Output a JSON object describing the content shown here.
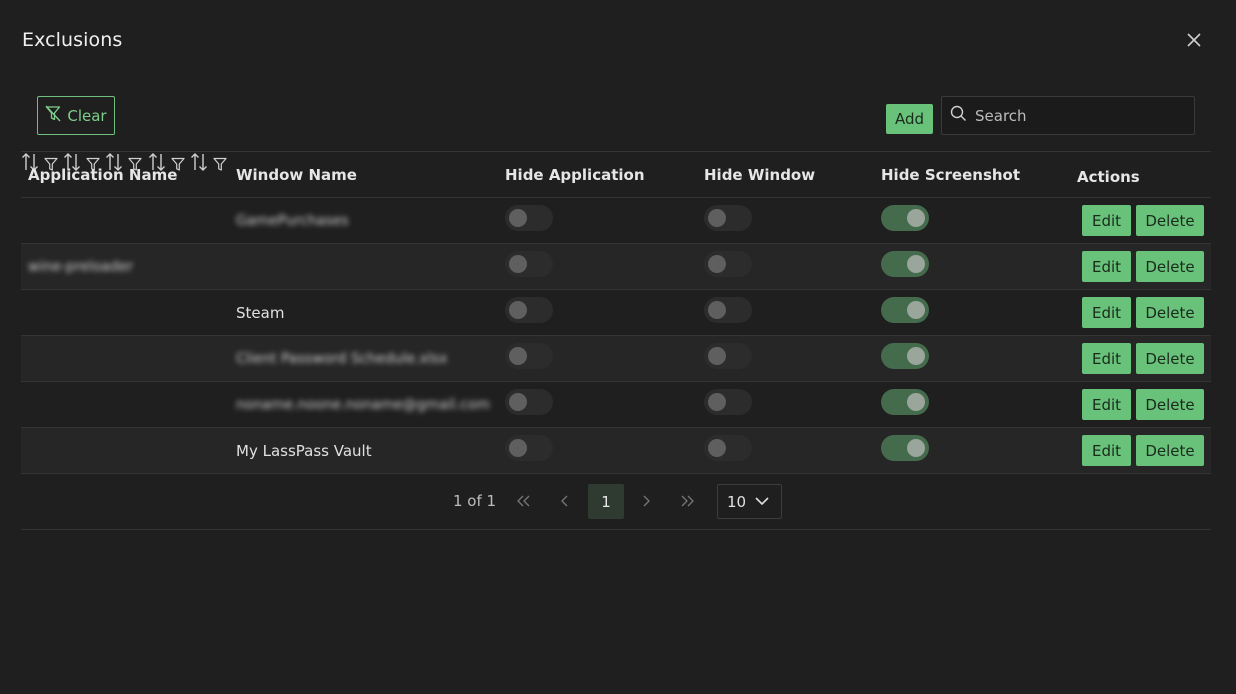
{
  "dialog": {
    "title": "Exclusions"
  },
  "toolbar": {
    "clear_label": "Clear",
    "add_label": "Add",
    "search_placeholder": "Search"
  },
  "columns": {
    "app_name": "Application Name",
    "window_name": "Window Name",
    "hide_application": "Hide Application",
    "hide_window": "Hide Window",
    "hide_screenshot": "Hide Screenshot",
    "actions": "Actions"
  },
  "rows": [
    {
      "app": "",
      "window": "GamePurchases",
      "window_blurred": true,
      "app_blurred": false,
      "hide_app": false,
      "hide_window": false,
      "hide_screenshot": true,
      "edit": "Edit",
      "delete": "Delete"
    },
    {
      "app": "wine-preloader",
      "window": "",
      "window_blurred": false,
      "app_blurred": true,
      "hide_app": false,
      "hide_window": false,
      "hide_screenshot": true,
      "edit": "Edit",
      "delete": "Delete"
    },
    {
      "app": "",
      "window": "Steam",
      "window_blurred": false,
      "app_blurred": false,
      "hide_app": false,
      "hide_window": false,
      "hide_screenshot": true,
      "edit": "Edit",
      "delete": "Delete"
    },
    {
      "app": "",
      "window": "Client Password Schedule.xlsx",
      "window_blurred": true,
      "app_blurred": false,
      "hide_app": false,
      "hide_window": false,
      "hide_screenshot": true,
      "edit": "Edit",
      "delete": "Delete"
    },
    {
      "app": "",
      "window": "noname.noone.noname@gmail.com",
      "window_blurred": true,
      "app_blurred": false,
      "hide_app": false,
      "hide_window": false,
      "hide_screenshot": true,
      "edit": "Edit",
      "delete": "Delete"
    },
    {
      "app": "",
      "window": "My LassPass Vault",
      "window_blurred": false,
      "app_blurred": false,
      "hide_app": false,
      "hide_window": false,
      "hide_screenshot": true,
      "edit": "Edit",
      "delete": "Delete"
    }
  ],
  "paginator": {
    "report": "1 of 1",
    "current_page": "1",
    "rows_per_page": "10"
  },
  "colors": {
    "accent": "#69c27a",
    "background": "#1f1f1f",
    "toggle_on": "#446b4b"
  },
  "icons": {
    "close": "close-icon",
    "clear": "filter-slash-icon",
    "search": "search-icon",
    "sort": "sort-icon",
    "filter": "filter-icon",
    "first": "double-chevron-left-icon",
    "prev": "chevron-left-icon",
    "next": "chevron-right-icon",
    "last": "double-chevron-right-icon",
    "dropdown": "chevron-down-icon"
  }
}
